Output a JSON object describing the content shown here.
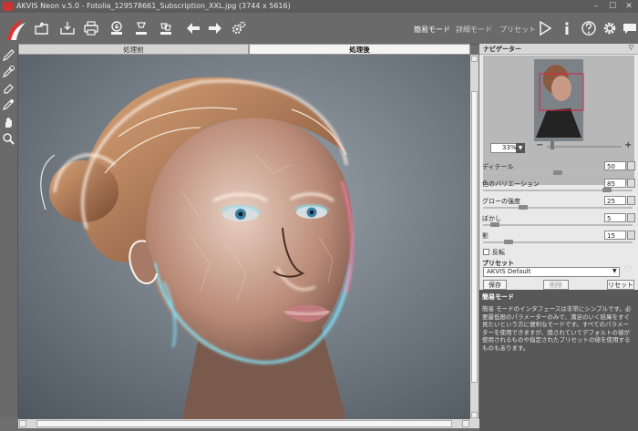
{
  "window": {
    "title": "AKVIS Neon v.5.0 - Fotolia_129578661_Subscription_XXL.jpg (3744 x 5616)",
    "controls": {
      "minimize": "–",
      "maximize": "☐",
      "close": "✕"
    }
  },
  "toolbar": {
    "modes": {
      "simple": "簡易モード",
      "advanced": "詳細モード",
      "presets": "プリセット"
    }
  },
  "canvas": {
    "tabs": {
      "before": "処理前",
      "after": "処理後"
    },
    "active_tab": "after"
  },
  "navigator": {
    "title": "ナビゲーター",
    "zoom": "33%",
    "zoom_out": "−",
    "zoom_in": "+"
  },
  "params": [
    {
      "label": "ディテール",
      "value": "50",
      "fraction": 0.5
    },
    {
      "label": "色のバリエーション",
      "value": "85",
      "fraction": 0.85
    },
    {
      "label": "グローの強度",
      "value": "25",
      "fraction": 0.25
    },
    {
      "label": "ぼかし",
      "value": "5",
      "fraction": 0.05
    },
    {
      "label": "影",
      "value": "15",
      "fraction": 0.15
    }
  ],
  "invert": {
    "label": "反転",
    "checked": false
  },
  "presets": {
    "title": "プリセット",
    "selected": "AKVIS Default",
    "save": "保存",
    "delete": "削除",
    "reset": "リセット"
  },
  "hint": {
    "title": "簡易モード",
    "body": "簡易 モードのインタフェースは非常にシンプルです。必要最低限のパラメーターのみで、満足のいく結果をすぐ見たいという方に便利なモードです。すべてのパラメーターを使用できますが、隠されていてデフォルトの値が使用されるものや指定されたプリセットの値を使用するものもあります。"
  },
  "colors": {
    "accent_red": "#c8303a",
    "neon_cyan": "#7fe8ff",
    "neon_white": "#fff4ea",
    "neon_pink": "#ff7aa8"
  }
}
